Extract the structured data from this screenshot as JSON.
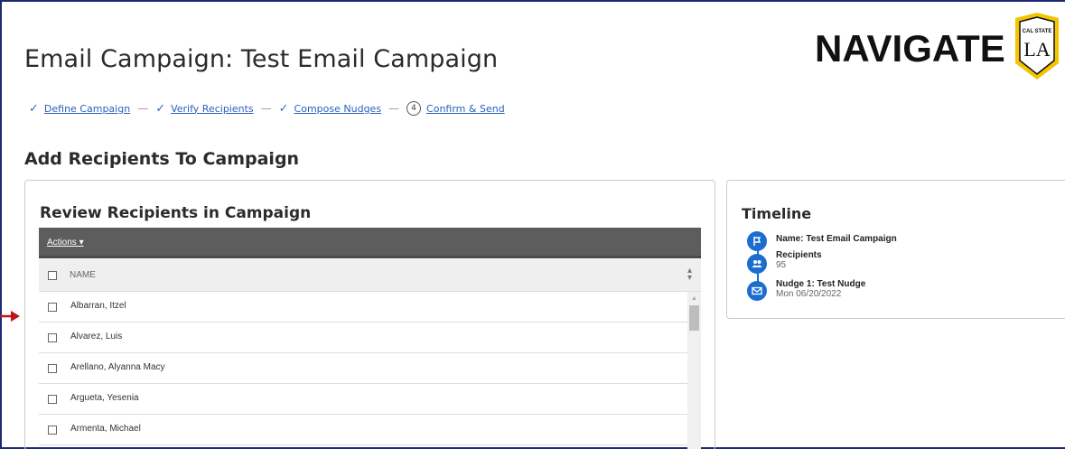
{
  "header": {
    "title": "Email Campaign: Test Email Campaign",
    "brand": "NAVIGATE",
    "seal": {
      "top": "CAL STATE",
      "main": "LA"
    }
  },
  "steps": [
    {
      "label": "Define Campaign",
      "done": true
    },
    {
      "label": "Verify Recipients",
      "done": true
    },
    {
      "label": "Compose Nudges",
      "done": true
    },
    {
      "label": "Confirm & Send",
      "done": false,
      "number": "4"
    }
  ],
  "section_title": "Add Recipients To Campaign",
  "recipients_panel": {
    "title": "Review Recipients in Campaign",
    "actions_label": "Actions ▾",
    "column_name": "NAME",
    "rows": [
      "Albarran, Itzel",
      "Alvarez, Luis",
      "Arellano, Alyanna Macy",
      "Argueta, Yesenia",
      "Armenta, Michael"
    ]
  },
  "timeline": {
    "title": "Timeline",
    "items": [
      {
        "label": "Name: Test Email Campaign",
        "value": "",
        "icon": "flag-icon"
      },
      {
        "label": "Recipients",
        "value": "95",
        "icon": "people-icon"
      },
      {
        "label": "Nudge 1: Test Nudge",
        "value": "Mon 06/20/2022",
        "icon": "mail-icon"
      }
    ]
  },
  "colors": {
    "frame_border": "#1c2a73",
    "link": "#2a5fbf",
    "timeline_accent": "#1c6dd0",
    "toolbar": "#5d5d5d",
    "arrow": "#c0111f"
  }
}
